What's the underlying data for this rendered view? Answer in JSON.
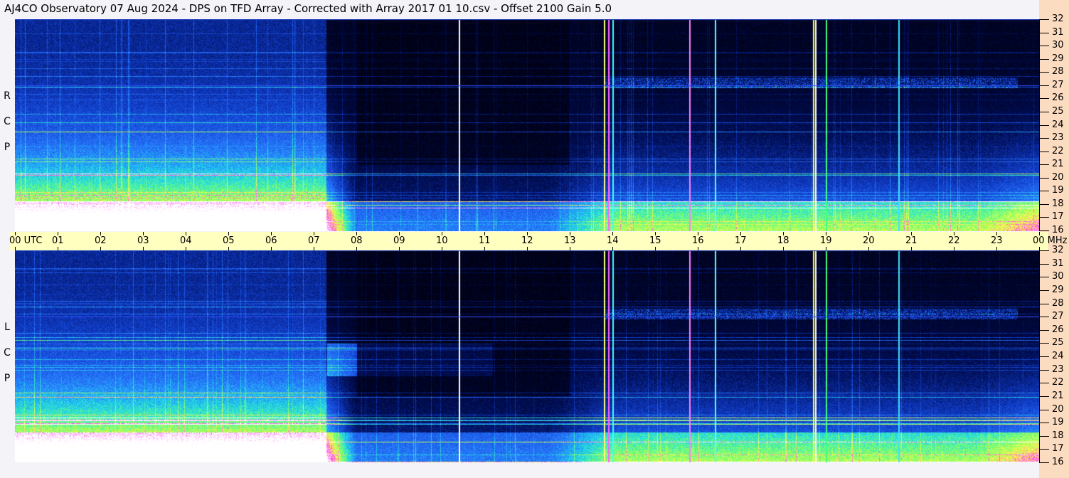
{
  "title": "AJ4CO Observatory  07 Aug 2024  -  DPS on TFD Array  -  Corrected with Array 2017 01 10.csv  -  Offset 2100  Gain 5.0",
  "chart_data": {
    "type": "heatmap",
    "title": "AJ4CO Observatory  07 Aug 2024  -  DPS on TFD Array  -  Corrected with Array 2017 01 10.csv  -  Offset 2100  Gain 5.0",
    "xlabel": "UTC",
    "ylabel": "MHz",
    "x_range": [
      0,
      24
    ],
    "y_range": [
      16,
      32
    ],
    "x_ticks": [
      "00 UTC",
      "01",
      "02",
      "03",
      "04",
      "05",
      "06",
      "07",
      "08",
      "09",
      "10",
      "11",
      "12",
      "13",
      "14",
      "15",
      "16",
      "17",
      "18",
      "19",
      "20",
      "21",
      "22",
      "23",
      "00 MHz"
    ],
    "y_ticks": [
      "32",
      "31",
      "30",
      "29",
      "28",
      "27",
      "26",
      "25",
      "24",
      "23",
      "22",
      "21",
      "20",
      "19",
      "18",
      "17",
      "16"
    ],
    "panels": [
      {
        "name": "RCP",
        "label": [
          "R",
          "C",
          "P"
        ]
      },
      {
        "name": "LCP",
        "label": [
          "L",
          "C",
          "P"
        ]
      }
    ],
    "interference_lines_utc": [
      10.4,
      13.8,
      13.9,
      14.0,
      15.8,
      16.4,
      18.7,
      18.75,
      19.0,
      20.7
    ],
    "strong_band_mhz": 27
  }
}
